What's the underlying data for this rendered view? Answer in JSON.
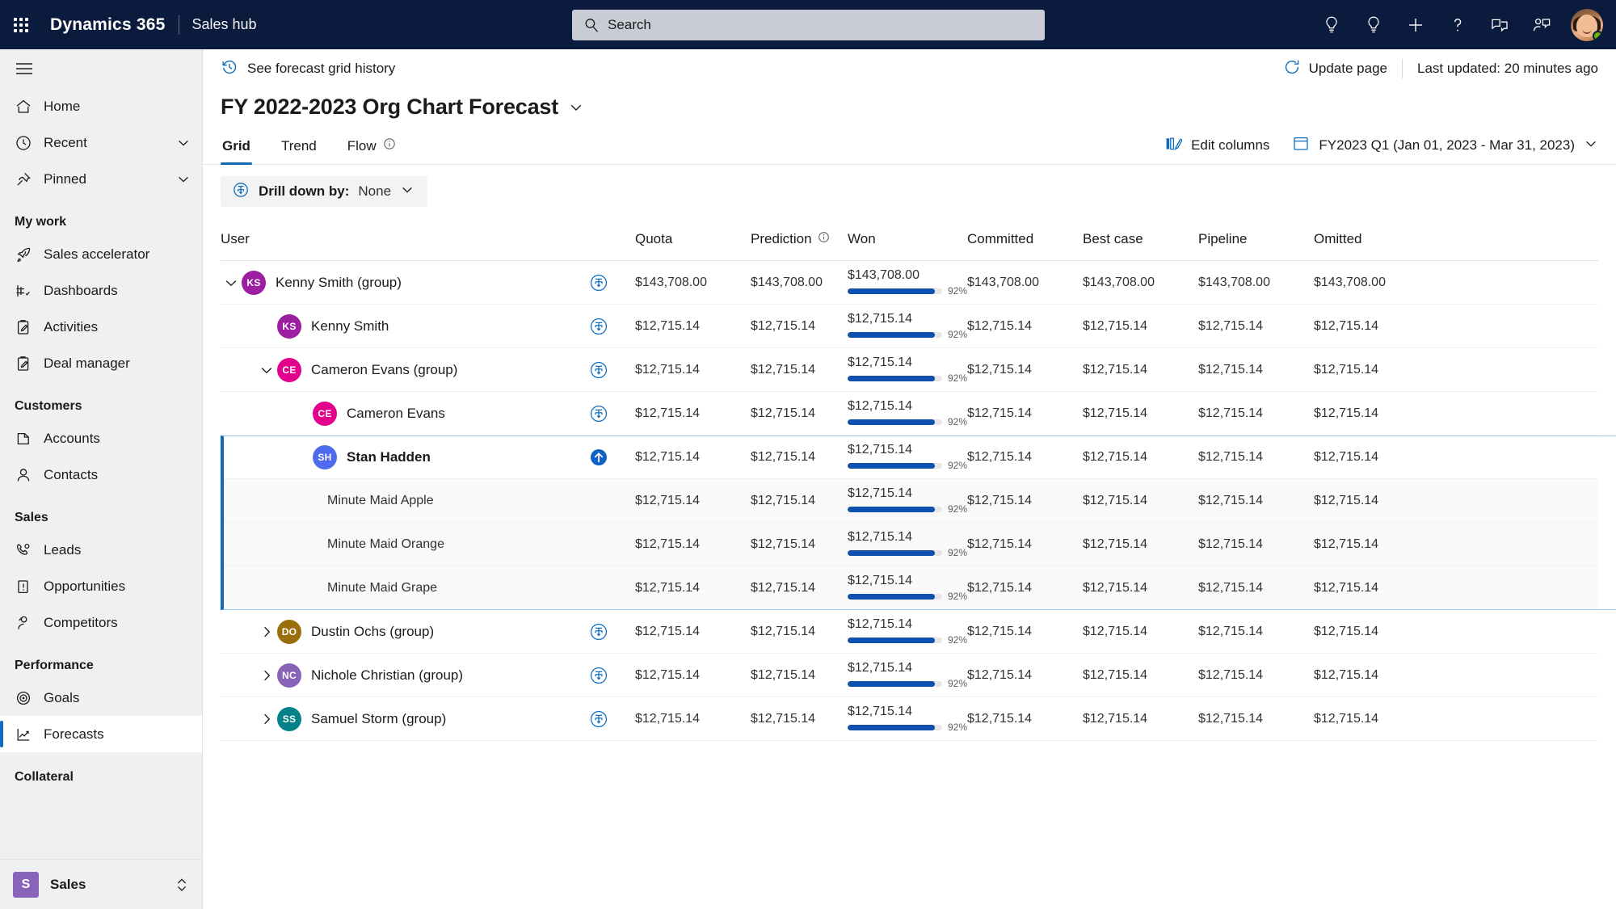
{
  "topbar": {
    "waffle_label": "app-launcher",
    "brand": "Dynamics 365",
    "app_name": "Sales hub",
    "search_placeholder": "Search",
    "actions": [
      {
        "name": "insights-icon",
        "label": "Insights"
      },
      {
        "name": "ideas-icon",
        "label": "Ideas"
      },
      {
        "name": "plus-icon",
        "label": "New"
      },
      {
        "name": "help-icon",
        "label": "Help"
      },
      {
        "name": "feedback-icon",
        "label": "Feedback"
      },
      {
        "name": "assistant-icon",
        "label": "Assistant"
      }
    ]
  },
  "sidebar": {
    "hamburger_label": "Show/Hide navigation",
    "top_items": [
      {
        "label": "Home",
        "icon": "home-icon",
        "expandable": false
      },
      {
        "label": "Recent",
        "icon": "clock-icon",
        "expandable": true
      },
      {
        "label": "Pinned",
        "icon": "pin-icon",
        "expandable": true
      }
    ],
    "groups": [
      {
        "title": "My work",
        "items": [
          {
            "label": "Sales accelerator",
            "icon": "rocket-icon"
          },
          {
            "label": "Dashboards",
            "icon": "dashboard-icon"
          },
          {
            "label": "Activities",
            "icon": "activities-icon"
          },
          {
            "label": "Deal manager",
            "icon": "deal-manager-icon"
          }
        ]
      },
      {
        "title": "Customers",
        "items": [
          {
            "label": "Accounts",
            "icon": "accounts-icon"
          },
          {
            "label": "Contacts",
            "icon": "contact-icon"
          }
        ]
      },
      {
        "title": "Sales",
        "items": [
          {
            "label": "Leads",
            "icon": "leads-icon"
          },
          {
            "label": "Opportunities",
            "icon": "opportunities-icon"
          },
          {
            "label": "Competitors",
            "icon": "competitors-icon"
          }
        ]
      },
      {
        "title": "Performance",
        "items": [
          {
            "label": "Goals",
            "icon": "goals-icon"
          },
          {
            "label": "Forecasts",
            "icon": "forecasts-icon",
            "selected": true
          }
        ]
      },
      {
        "title": "Collateral",
        "items": []
      }
    ],
    "app_switcher": {
      "initial": "S",
      "label": "Sales"
    }
  },
  "command_bar": {
    "history_label": "See forecast grid history",
    "update_page_label": "Update page",
    "last_updated": "Last updated: 20 minutes ago"
  },
  "page": {
    "title": "FY 2022-2023 Org Chart Forecast",
    "tabs": [
      {
        "label": "Grid",
        "active": true,
        "info": false
      },
      {
        "label": "Trend",
        "active": false,
        "info": false
      },
      {
        "label": "Flow",
        "active": false,
        "info": true
      }
    ],
    "edit_columns_label": "Edit columns",
    "period_label": "FY2023 Q1 (Jan 01, 2023 - Mar 31, 2023)",
    "drill_down_label": "Drill down by:",
    "drill_down_value": "None"
  },
  "grid": {
    "columns": [
      {
        "key": "user",
        "label": "User",
        "info": false
      },
      {
        "key": "quota",
        "label": "Quota",
        "info": false
      },
      {
        "key": "prediction",
        "label": "Prediction",
        "info": true
      },
      {
        "key": "won",
        "label": "Won",
        "info": false
      },
      {
        "key": "committed",
        "label": "Committed",
        "info": false
      },
      {
        "key": "best_case",
        "label": "Best case",
        "info": false
      },
      {
        "key": "pipeline",
        "label": "Pipeline",
        "info": false
      },
      {
        "key": "omitted",
        "label": "Omitted",
        "info": false
      }
    ],
    "rows": [
      {
        "name": "Kenny Smith (group)",
        "indent": 0,
        "type": "group",
        "expanded": true,
        "initials": "KS",
        "avatar_color": "#9b1fa0",
        "drill_icon": "drill-down-icon",
        "selected": false,
        "alt": false,
        "quota": "$143,708.00",
        "prediction": "$143,708.00",
        "won": "$143,708.00",
        "won_pct": "92%",
        "won_pct_value": 92,
        "committed": "$143,708.00",
        "best_case": "$143,708.00",
        "pipeline": "$143,708.00",
        "omitted": "$143,708.00"
      },
      {
        "name": "Kenny Smith",
        "indent": 1,
        "type": "user",
        "expanded": null,
        "initials": "KS",
        "avatar_color": "#9b1fa0",
        "drill_icon": "drill-down-icon",
        "selected": false,
        "alt": false,
        "quota": "$12,715.14",
        "prediction": "$12,715.14",
        "won": "$12,715.14",
        "won_pct": "92%",
        "won_pct_value": 92,
        "committed": "$12,715.14",
        "best_case": "$12,715.14",
        "pipeline": "$12,715.14",
        "omitted": "$12,715.14"
      },
      {
        "name": "Cameron Evans (group)",
        "indent": 1,
        "type": "group",
        "expanded": true,
        "initials": "CE",
        "avatar_color": "#e3008c",
        "drill_icon": "drill-down-icon",
        "selected": false,
        "alt": false,
        "quota": "$12,715.14",
        "prediction": "$12,715.14",
        "won": "$12,715.14",
        "won_pct": "92%",
        "won_pct_value": 92,
        "committed": "$12,715.14",
        "best_case": "$12,715.14",
        "pipeline": "$12,715.14",
        "omitted": "$12,715.14"
      },
      {
        "name": "Cameron Evans",
        "indent": 2,
        "type": "user",
        "expanded": null,
        "initials": "CE",
        "avatar_color": "#e3008c",
        "drill_icon": "drill-down-icon",
        "selected": false,
        "alt": false,
        "quota": "$12,715.14",
        "prediction": "$12,715.14",
        "won": "$12,715.14",
        "won_pct": "92%",
        "won_pct_value": 92,
        "committed": "$12,715.14",
        "best_case": "$12,715.14",
        "pipeline": "$12,715.14",
        "omitted": "$12,715.14"
      },
      {
        "name": "Stan Hadden",
        "indent": 2,
        "type": "user",
        "expanded": null,
        "initials": "SH",
        "avatar_color": "#4f6bed",
        "drill_icon": "drill-up-icon",
        "selected": true,
        "alt": false,
        "quota": "$12,715.14",
        "prediction": "$12,715.14",
        "won": "$12,715.14",
        "won_pct": "92%",
        "won_pct_value": 92,
        "committed": "$12,715.14",
        "best_case": "$12,715.14",
        "pipeline": "$12,715.14",
        "omitted": "$12,715.14"
      },
      {
        "name": "Minute Maid Apple",
        "indent": 3,
        "type": "opportunity",
        "expanded": null,
        "initials": "",
        "avatar_color": "",
        "drill_icon": "",
        "selected": false,
        "alt": true,
        "quota": "$12,715.14",
        "prediction": "$12,715.14",
        "won": "$12,715.14",
        "won_pct": "92%",
        "won_pct_value": 92,
        "committed": "$12,715.14",
        "best_case": "$12,715.14",
        "pipeline": "$12,715.14",
        "omitted": "$12,715.14"
      },
      {
        "name": "Minute Maid Orange",
        "indent": 3,
        "type": "opportunity",
        "expanded": null,
        "initials": "",
        "avatar_color": "",
        "drill_icon": "",
        "selected": false,
        "alt": true,
        "quota": "$12,715.14",
        "prediction": "$12,715.14",
        "won": "$12,715.14",
        "won_pct": "92%",
        "won_pct_value": 92,
        "committed": "$12,715.14",
        "best_case": "$12,715.14",
        "pipeline": "$12,715.14",
        "omitted": "$12,715.14"
      },
      {
        "name": "Minute Maid Grape",
        "indent": 3,
        "type": "opportunity",
        "expanded": null,
        "initials": "",
        "avatar_color": "",
        "drill_icon": "",
        "selected": false,
        "alt": true,
        "quota": "$12,715.14",
        "prediction": "$12,715.14",
        "won": "$12,715.14",
        "won_pct": "92%",
        "won_pct_value": 92,
        "committed": "$12,715.14",
        "best_case": "$12,715.14",
        "pipeline": "$12,715.14",
        "omitted": "$12,715.14"
      },
      {
        "name": "Dustin Ochs (group)",
        "indent": 1,
        "type": "group",
        "expanded": false,
        "initials": "DO",
        "avatar_color": "#986f0b",
        "drill_icon": "drill-down-icon",
        "selected": false,
        "alt": false,
        "quota": "$12,715.14",
        "prediction": "$12,715.14",
        "won": "$12,715.14",
        "won_pct": "92%",
        "won_pct_value": 92,
        "committed": "$12,715.14",
        "best_case": "$12,715.14",
        "pipeline": "$12,715.14",
        "omitted": "$12,715.14"
      },
      {
        "name": "Nichole Christian (group)",
        "indent": 1,
        "type": "group",
        "expanded": false,
        "initials": "NC",
        "avatar_color": "#8764b8",
        "drill_icon": "drill-down-icon",
        "selected": false,
        "alt": false,
        "quota": "$12,715.14",
        "prediction": "$12,715.14",
        "won": "$12,715.14",
        "won_pct": "92%",
        "won_pct_value": 92,
        "committed": "$12,715.14",
        "best_case": "$12,715.14",
        "pipeline": "$12,715.14",
        "omitted": "$12,715.14"
      },
      {
        "name": "Samuel Storm (group)",
        "indent": 1,
        "type": "group",
        "expanded": false,
        "initials": "SS",
        "avatar_color": "#038387",
        "drill_icon": "drill-down-icon",
        "selected": false,
        "alt": false,
        "quota": "$12,715.14",
        "prediction": "$12,715.14",
        "won": "$12,715.14",
        "won_pct": "92%",
        "won_pct_value": 92,
        "committed": "$12,715.14",
        "best_case": "$12,715.14",
        "pipeline": "$12,715.14",
        "omitted": "$12,715.14"
      }
    ]
  },
  "colors": {
    "brand_navy": "#0b1b3d",
    "accent_blue": "#0f6cbd",
    "progress_blue": "#0f4fad",
    "sidebar_bg": "#f0f0f0",
    "selection_border": "#9ecbf0"
  }
}
